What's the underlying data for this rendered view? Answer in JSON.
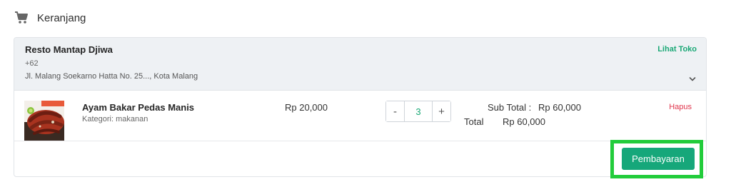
{
  "header": {
    "icon": "cart-icon",
    "title": "Keranjang"
  },
  "store": {
    "name": "Resto Mantap Djiwa",
    "phone": "+62",
    "address": "Jl. Malang Soekarno Hatta No. 25..., Kota Malang",
    "view_store_label": "Lihat Toko",
    "expand_icon": "chevron-down-icon"
  },
  "items": [
    {
      "name": "Ayam Bakar Pedas Manis",
      "category": "Kategori: makanan",
      "price": "Rp 20,000",
      "quantity": "3",
      "decrement_label": "-",
      "increment_label": "+",
      "subtotal_label": "Sub Total :",
      "subtotal_value": "Rp 60,000",
      "remove_label": "Hapus"
    }
  ],
  "summary": {
    "total_label": "Total",
    "total_value": "Rp 60,000",
    "pay_label": "Pembayaran"
  },
  "colors": {
    "accent": "#16a77a",
    "danger": "#e0344b",
    "header_bg": "#eef1f4",
    "highlight": "#22cc3b"
  }
}
